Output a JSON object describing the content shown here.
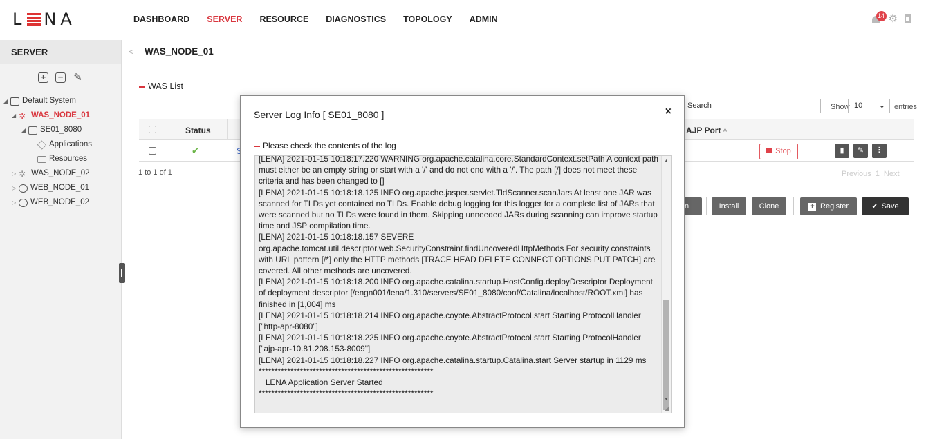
{
  "app": {
    "logo_left": "L",
    "logo_right": "NA",
    "nav": [
      "DASHBOARD",
      "SERVER",
      "RESOURCE",
      "DIAGNOSTICS",
      "TOPOLOGY",
      "ADMIN"
    ],
    "active_nav": "SERVER",
    "notification_count": "14",
    "accent_color": "#d9363e"
  },
  "sidebar": {
    "title": "SERVER",
    "tree": [
      {
        "label": "Default System",
        "level": 0,
        "icon": "system-icon"
      },
      {
        "label": "WAS_NODE_01",
        "level": 1,
        "icon": "was-node-icon",
        "selected": true
      },
      {
        "label": "SE01_8080",
        "level": 2,
        "icon": "server-icon"
      },
      {
        "label": "Applications",
        "level": 3,
        "icon": "applications-icon"
      },
      {
        "label": "Resources",
        "level": 3,
        "icon": "resources-icon"
      },
      {
        "label": "WAS_NODE_02",
        "level": 1,
        "icon": "was-node-icon"
      },
      {
        "label": "WEB_NODE_01",
        "level": 1,
        "icon": "web-node-icon"
      },
      {
        "label": "WEB_NODE_02",
        "level": 1,
        "icon": "web-node-icon"
      }
    ]
  },
  "main": {
    "breadcrumb_title": "WAS_NODE_01",
    "section_title": "WAS List",
    "search_label": "Search",
    "search_value": "",
    "show_label": "Show",
    "show_value": "10",
    "entries_label": "entries",
    "columns": {
      "status": "Status",
      "ajp_port": "AJP Port"
    },
    "row": {
      "status": "running",
      "server_link": "S"
    },
    "stop_label": "Stop",
    "count_text": "1 to 1 of 1",
    "pager": {
      "previous": "Previous",
      "page": "1",
      "next": "Next"
    },
    "buttons": {
      "partial": "on",
      "install": "Install",
      "clone": "Clone",
      "register": "Register",
      "save": "Save"
    }
  },
  "modal": {
    "title": "Server Log Info [ SE01_8080 ]",
    "close": "×",
    "subtitle": "Please check the contents of the log",
    "log": "[LENA] 2021-01-15 10:18:17.220 WARNING org.apache.catalina.core.StandardContext.setPath A context path must either be an empty string or start with a '/' and do not end with a '/'. The path [/] does not meet these criteria and has been changed to []\n[LENA] 2021-01-15 10:18:18.125 INFO org.apache.jasper.servlet.TldScanner.scanJars At least one JAR was scanned for TLDs yet contained no TLDs. Enable debug logging for this logger for a complete list of JARs that were scanned but no TLDs were found in them. Skipping unneeded JARs during scanning can improve startup time and JSP compilation time.\n[LENA] 2021-01-15 10:18:18.157 SEVERE org.apache.tomcat.util.descriptor.web.SecurityConstraint.findUncoveredHttpMethods For security constraints with URL pattern [/*] only the HTTP methods [TRACE HEAD DELETE CONNECT OPTIONS PUT PATCH] are covered. All other methods are uncovered.\n[LENA] 2021-01-15 10:18:18.200 INFO org.apache.catalina.startup.HostConfig.deployDescriptor Deployment of deployment descriptor [/engn001/lena/1.310/servers/SE01_8080/conf/Catalina/localhost/ROOT.xml] has finished in [1,004] ms\n[LENA] 2021-01-15 10:18:18.214 INFO org.apache.coyote.AbstractProtocol.start Starting ProtocolHandler [\"http-apr-8080\"]\n[LENA] 2021-01-15 10:18:18.225 INFO org.apache.coyote.AbstractProtocol.start Starting ProtocolHandler [\"ajp-apr-10.81.208.153-8009\"]\n[LENA] 2021-01-15 10:18:18.227 INFO org.apache.catalina.startup.Catalina.start Server startup in 1129 ms\n*******************************************************\n   LENA Application Server Started\n*******************************************************"
  }
}
